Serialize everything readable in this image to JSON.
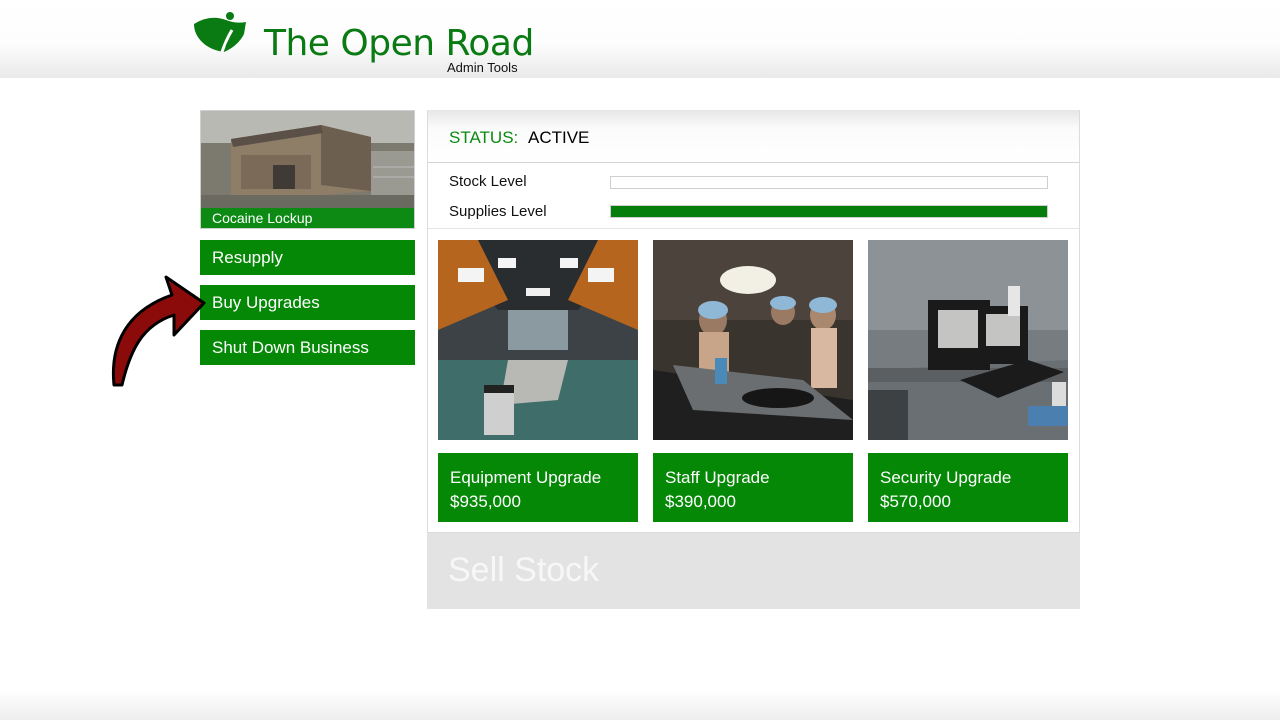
{
  "header": {
    "title": "The Open Road",
    "subtitle": "Admin Tools"
  },
  "property": {
    "name": "Cocaine Lockup"
  },
  "sidebar": {
    "buttons": [
      {
        "label": "Resupply"
      },
      {
        "label": "Buy Upgrades"
      },
      {
        "label": "Shut Down Business"
      }
    ]
  },
  "status": {
    "label": "STATUS:",
    "value": "ACTIVE"
  },
  "levels": [
    {
      "label": "Stock Level",
      "fraction": 0.0
    },
    {
      "label": "Supplies Level",
      "fraction": 1.0
    }
  ],
  "upgrades": [
    {
      "name": "Equipment Upgrade",
      "price": "$935,000"
    },
    {
      "name": "Staff Upgrade",
      "price": "$390,000"
    },
    {
      "name": "Security Upgrade",
      "price": "$570,000"
    }
  ],
  "sell": {
    "label": "Sell Stock"
  },
  "colors": {
    "brand_green": "#058806",
    "status_green": "#0a8a12",
    "annotation_arrow": "#8b0b0b"
  }
}
